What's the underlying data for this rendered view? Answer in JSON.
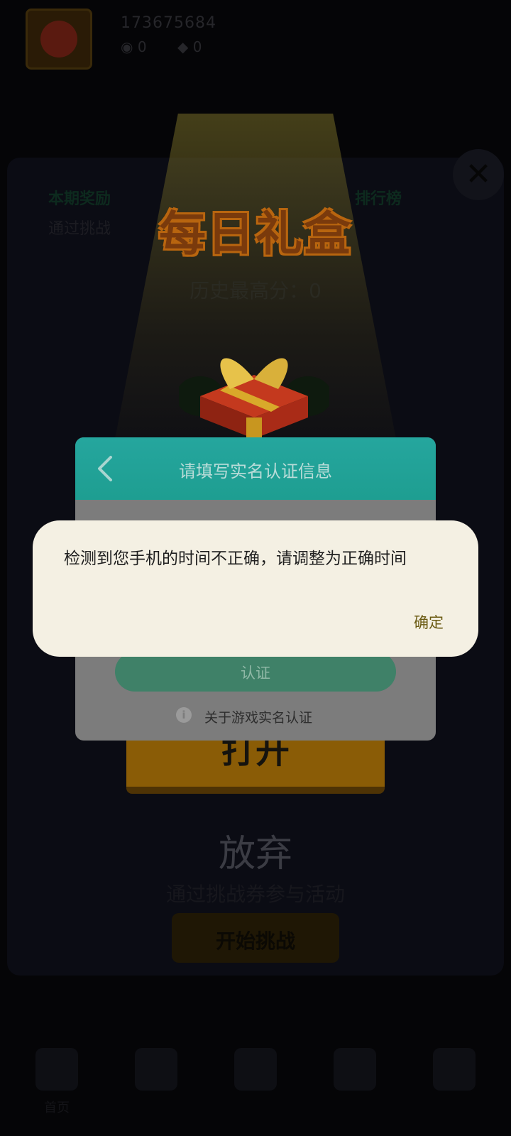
{
  "topbar": {
    "user_id": "173675684",
    "coins": "0",
    "gems": "0"
  },
  "background": {
    "panel_left_title": "本期奖励",
    "panel_right_title": "排行榜",
    "panel_left_sub": "通过挑战",
    "daily_title": "每日礼盒",
    "high_score": "历史最高分：0",
    "open_button": "打开",
    "abandon": "放弃",
    "coupon_hint": "通过挑战券参与活动",
    "start_button": "开始挑战"
  },
  "bottom_nav": {
    "items": [
      {
        "label": "首页",
        "icon": "home-icon"
      },
      {
        "label": "",
        "icon": "nav-icon"
      },
      {
        "label": "",
        "icon": "nav-icon"
      },
      {
        "label": "",
        "icon": "nav-icon"
      },
      {
        "label": "",
        "icon": "nav-icon"
      }
    ]
  },
  "verify_dialog": {
    "title": "请填写实名认证信息",
    "submit_label": "认证",
    "about_link": "关于游戏实名认证"
  },
  "alert": {
    "message": "检测到您手机的时间不正确，请调整为正确时间",
    "ok_label": "确定"
  }
}
